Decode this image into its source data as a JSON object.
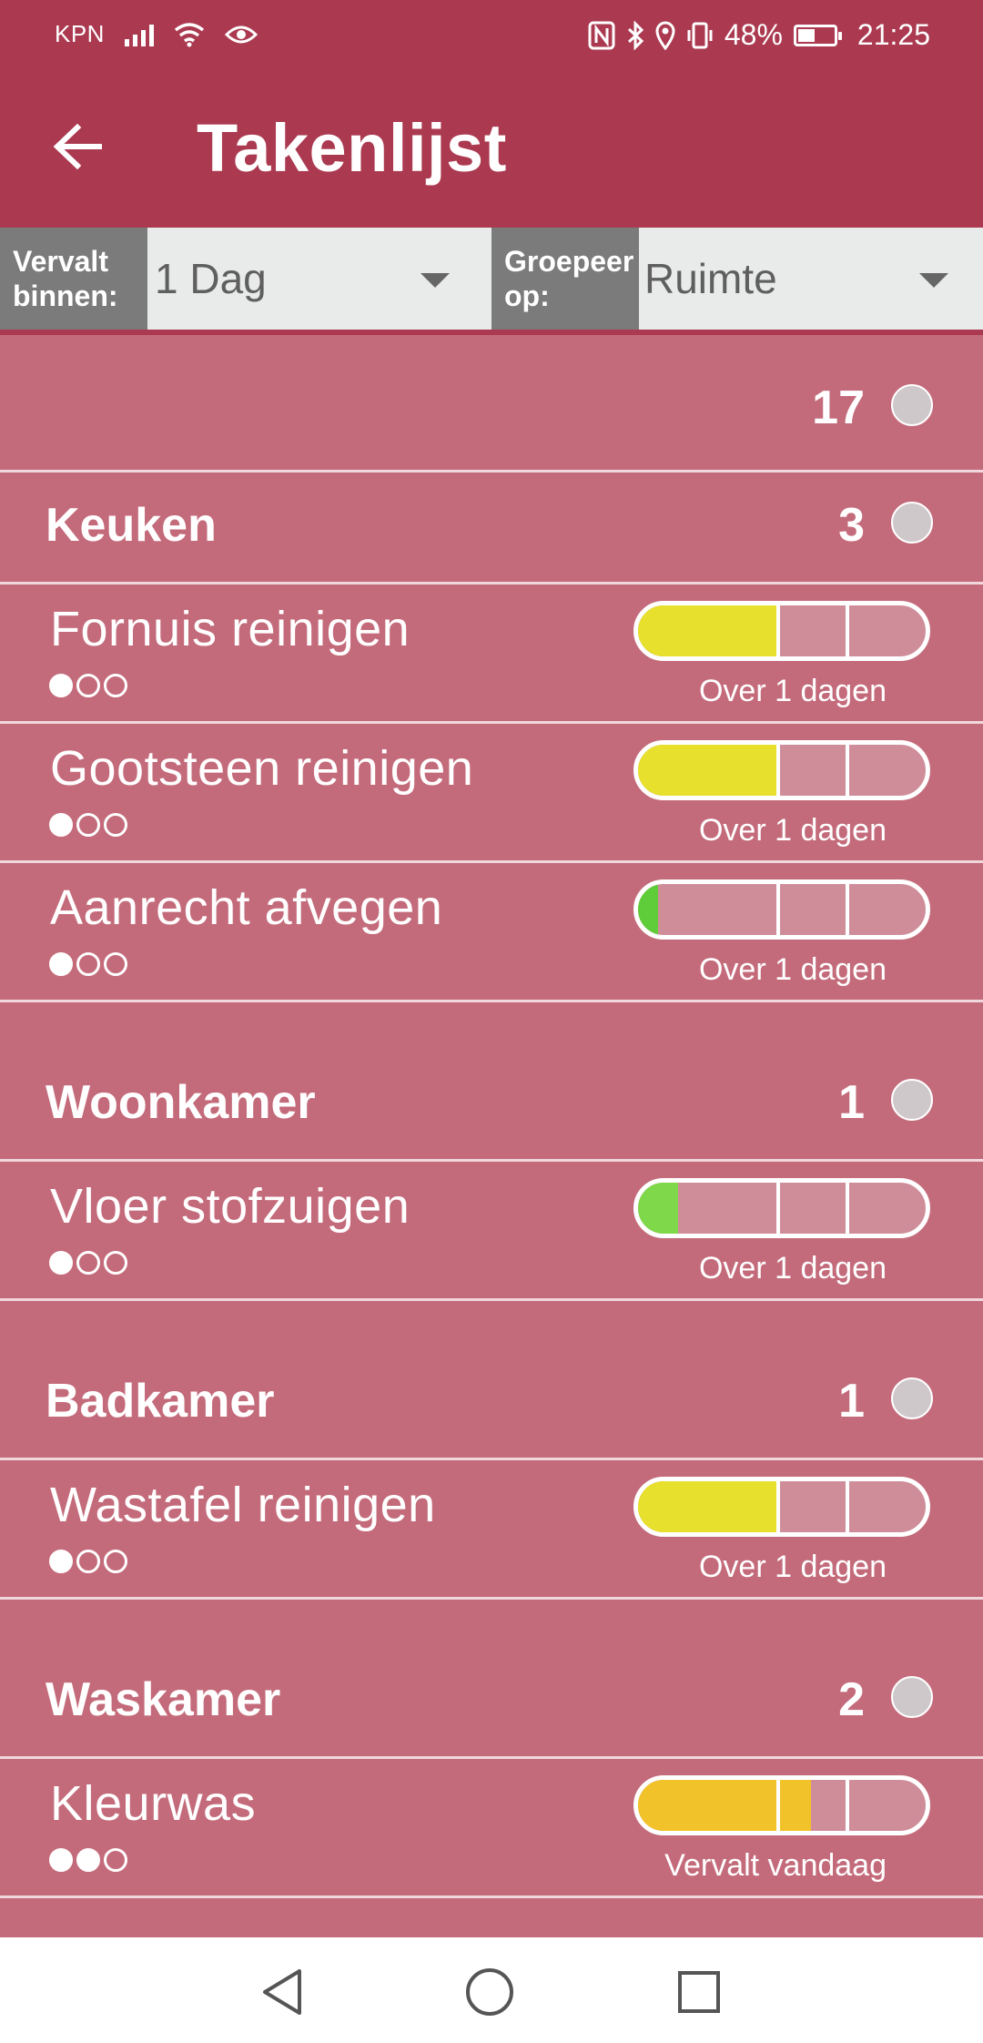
{
  "status_bar": {
    "carrier": "KPN",
    "battery": "48%",
    "time": "21:25"
  },
  "app_bar": {
    "title": "Takenlijst",
    "back_icon": "arrow-left-icon"
  },
  "filters": {
    "due_label": "Vervalt binnen:",
    "due_value": "1 Dag",
    "group_label": "Groepeer op:",
    "group_value": "Ruimte"
  },
  "total_count": "17",
  "groups": [
    {
      "title": "Keuken",
      "count": "3",
      "tasks": [
        {
          "name": "Fornuis reinigen",
          "priority": 1,
          "progress": 0.48,
          "color": "#e7e02d",
          "due": "Over 1 dagen"
        },
        {
          "name": "Gootsteen reinigen",
          "priority": 1,
          "progress": 0.48,
          "color": "#e7e02d",
          "due": "Over 1 dagen"
        },
        {
          "name": "Aanrecht afvegen",
          "priority": 1,
          "progress": 0.07,
          "color": "#5fcc3a",
          "due": "Over 1 dagen"
        }
      ]
    },
    {
      "title": "Woonkamer",
      "count": "1",
      "tasks": [
        {
          "name": "Vloer stofzuigen",
          "priority": 1,
          "progress": 0.14,
          "color": "#7fd84a",
          "due": "Over 1 dagen"
        }
      ]
    },
    {
      "title": "Badkamer",
      "count": "1",
      "tasks": [
        {
          "name": "Wastafel reinigen",
          "priority": 1,
          "progress": 0.48,
          "color": "#e7e02d",
          "due": "Over 1 dagen"
        }
      ]
    },
    {
      "title": "Waskamer",
      "count": "2",
      "tasks": [
        {
          "name": "Kleurwas",
          "priority": 2,
          "progress": 0.6,
          "color": "#f2c22a",
          "due": "Vervalt vandaag"
        }
      ]
    }
  ],
  "nav": {
    "back_icon": "triangle-back-icon",
    "home_icon": "circle-home-icon",
    "recents_icon": "square-recents-icon"
  }
}
